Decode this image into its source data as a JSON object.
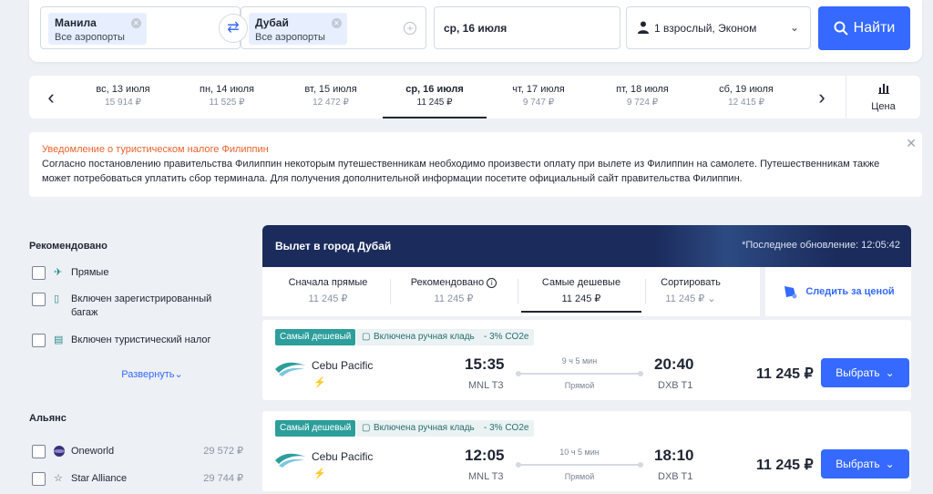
{
  "search": {
    "from": {
      "city": "Манила",
      "airports": "Все аэропорты"
    },
    "to": {
      "city": "Дубай",
      "airports": "Все аэропорты"
    },
    "date": "ср, 16 июля",
    "passengers": "1 взрослый, Эконом",
    "find_label": "Найти"
  },
  "date_strip": {
    "days": [
      {
        "label": "вс, 13 июля",
        "price": "15 914 ₽"
      },
      {
        "label": "пн, 14 июля",
        "price": "11 525 ₽"
      },
      {
        "label": "вт, 15 июля",
        "price": "12 472 ₽"
      },
      {
        "label": "ср, 16 июля",
        "price": "11 245 ₽",
        "selected": true
      },
      {
        "label": "чт, 17 июля",
        "price": "9 747 ₽"
      },
      {
        "label": "пт, 18 июля",
        "price": "9 724 ₽"
      },
      {
        "label": "сб, 19 июля",
        "price": "12 415 ₽"
      }
    ],
    "price_tab_label": "Цена"
  },
  "notice": {
    "title": "Уведомление о туристическом налоге Филиппин",
    "body": "Согласно постановлению правительства Филиппин некоторым путешественникам необходимо произвести оплату при вылете из Филиппин на самолете. Путешественникам также может потребоваться уплатить сбор терминала. Для получения дополнительной информации посетите официальный сайт правительства Филиппин."
  },
  "filters": {
    "recommended_title": "Рекомендовано",
    "recommended": [
      {
        "label": "Прямые",
        "icon": "plane-icon"
      },
      {
        "label": "Включен зарегистрированный багаж",
        "icon": "luggage-icon"
      },
      {
        "label": "Включен туристический налог",
        "icon": "tax-icon"
      }
    ],
    "expand_label": "Развернуть",
    "alliance_title": "Альянс",
    "alliances": [
      {
        "label": "Oneworld",
        "price": "29 572 ₽"
      },
      {
        "label": "Star Alliance",
        "price": "29 744 ₽"
      }
    ]
  },
  "results": {
    "title": "Вылет в город Дубай",
    "updated": "*Последнее обновление: 12:05:42",
    "sort": [
      {
        "label": "Сначала прямые",
        "price": "11 245 ₽"
      },
      {
        "label": "Рекомендовано",
        "price": "11 245 ₽"
      },
      {
        "label": "Самые дешевые",
        "price": "11 245 ₽",
        "active": true
      },
      {
        "label": "Сортировать",
        "price": "11 245 ₽"
      }
    ],
    "follow_label": "Следить за ценой",
    "flights": [
      {
        "badge_cheap": "Самый дешевый",
        "badge_bag": "Включена ручная кладь",
        "badge_co2": "- 3% CO2e",
        "airline": "Cebu Pacific",
        "dep_time": "15:35",
        "dep_airport": "MNL T3",
        "duration": "9 ч 5 мин",
        "stops": "Прямой",
        "arr_time": "20:40",
        "arr_airport": "DXB T1",
        "price": "11 245 ₽",
        "select_label": "Выбрать"
      },
      {
        "badge_cheap": "Самый дешевый",
        "badge_bag": "Включена ручная кладь",
        "badge_co2": "- 3% CO2e",
        "airline": "Cebu Pacific",
        "dep_time": "12:05",
        "dep_airport": "MNL T3",
        "duration": "10 ч 5 мин",
        "stops": "Прямой",
        "arr_time": "18:10",
        "arr_airport": "DXB T1",
        "price": "11 245 ₽",
        "select_label": "Выбрать"
      }
    ]
  },
  "colors": {
    "accent": "#3569ff",
    "header_bg": "#1b2b5c",
    "badge_teal": "#2c9e9b",
    "notice_title": "#e8632b"
  }
}
